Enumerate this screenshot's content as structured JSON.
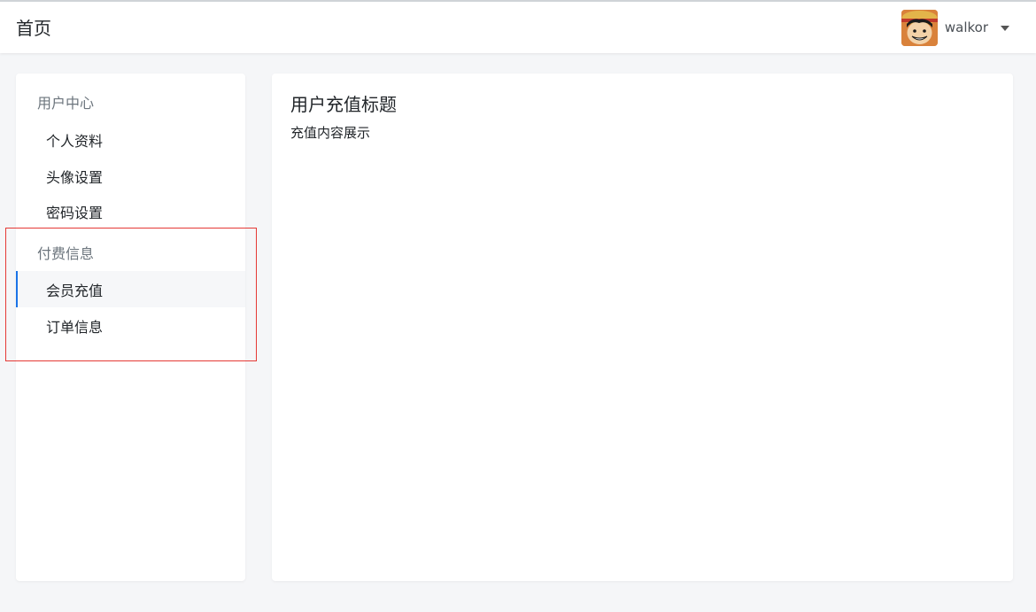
{
  "header": {
    "title": "首页",
    "user": {
      "name": "walkor",
      "avatar_icon": "user-avatar-icon",
      "dropdown_icon": "caret-down-icon"
    }
  },
  "sidebar": {
    "groups": [
      {
        "title": "用户中心",
        "items": [
          {
            "label": "个人资料"
          },
          {
            "label": "头像设置"
          },
          {
            "label": "密码设置"
          }
        ]
      },
      {
        "title": "付费信息",
        "items": [
          {
            "label": "会员充值",
            "active": true
          },
          {
            "label": "订单信息"
          }
        ]
      }
    ]
  },
  "main": {
    "title": "用户充值标题",
    "body": "充值内容展示"
  },
  "colors": {
    "accent": "#1a73e8",
    "highlight_border": "#e53935",
    "page_bg": "#f5f6f8"
  }
}
